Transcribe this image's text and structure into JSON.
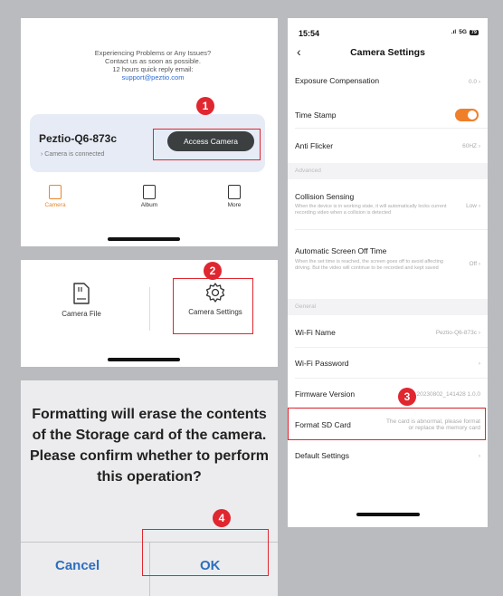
{
  "home": {
    "support_lines": [
      "Experiencing Problems or Any Issues?",
      "Contact us as soon as possible.",
      "12 hours quick reply email:"
    ],
    "support_email": "support@peztio.com",
    "camera_name": "Peztio-Q6-873c",
    "camera_status": "Camera is connected",
    "access_button": "Access Camera",
    "nav": [
      {
        "label": "Camera",
        "icon": "camera-icon",
        "active": true
      },
      {
        "label": "Album",
        "icon": "album-icon",
        "active": false
      },
      {
        "label": "More",
        "icon": "more-icon",
        "active": false
      }
    ]
  },
  "tools": {
    "camera_file": "Camera File",
    "camera_settings": "Camera Settings"
  },
  "dialog": {
    "message": "Formatting will erase the contents of the Storage card of the camera. Please confirm whether to perform this operation?",
    "cancel": "Cancel",
    "ok": "OK"
  },
  "steps": [
    "1",
    "2",
    "3",
    "4"
  ],
  "settings": {
    "status_time": "15:54",
    "status_network": "5G",
    "status_battery": "79",
    "title": "Camera Settings",
    "exposure": {
      "label": "Exposure Compensation",
      "value": "0.0"
    },
    "timestamp": {
      "label": "Time Stamp",
      "enabled": true
    },
    "anti_flicker": {
      "label": "Anti Flicker",
      "value": "60HZ"
    },
    "section_advanced": "Advanced",
    "collision": {
      "label": "Collision Sensing",
      "value": "Low",
      "desc": "When the device is in working state, it will automatically locks current recording video when a collision is detected"
    },
    "auto_off": {
      "label": "Automatic Screen Off Time",
      "value": "Off",
      "desc": "When the set time is reached, the screen goes off to avoid affecting driving. But the video will continue to be recorded and kept saved"
    },
    "section_general": "General",
    "wifi_name": {
      "label": "Wi-Fi Name",
      "value": "Peztio-Q6-873c"
    },
    "wifi_password": {
      "label": "Wi-Fi Password"
    },
    "firmware": {
      "label": "Firmware Version",
      "value": "20230802_141428 1.0.0"
    },
    "format_sd": {
      "label": "Format SD Card",
      "value": "The card is abnormal, please format or replace the memory card"
    },
    "default_settings": {
      "label": "Default Settings"
    }
  },
  "colors": {
    "accent_red": "#e0262f",
    "toggle_orange": "#f07f2a",
    "link_blue": "#2c6fbf",
    "background": "#b9bbbe"
  }
}
